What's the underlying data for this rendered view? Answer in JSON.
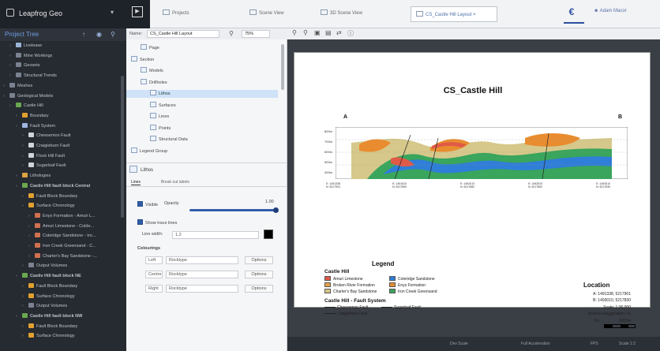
{
  "app": {
    "title": "Leapfrog Geo",
    "tabs": [
      {
        "label": "Projects"
      },
      {
        "label": "Scene View"
      },
      {
        "label": "3D Scene View"
      },
      {
        "label": "CS_Castle Hill Layout ×"
      }
    ],
    "user": "Adam Macor"
  },
  "tree": {
    "title": "Project Tree",
    "items": [
      {
        "label": "Livelease",
        "indent": 1,
        "color": "#9bb3d6"
      },
      {
        "label": "Mine Workings",
        "indent": 1,
        "color": "#7a8290"
      },
      {
        "label": "Geosets",
        "indent": 1,
        "color": "#7a8290"
      },
      {
        "label": "Structural Trends",
        "indent": 1,
        "color": "#7a8290"
      },
      {
        "label": "Meshes",
        "indent": 0,
        "color": "#7a8290"
      },
      {
        "label": "Geological Models",
        "indent": 0,
        "color": "#7a8290"
      },
      {
        "label": "Castle Hill",
        "indent": 1,
        "color": "#6aa84f"
      },
      {
        "label": "Boundary",
        "indent": 2,
        "color": "#e0a030"
      },
      {
        "label": "Fault System",
        "indent": 2,
        "color": "#9fb7e0"
      },
      {
        "label": "Cheesemon Fault",
        "indent": 3,
        "color": "#cfd3da"
      },
      {
        "label": "Craigieburn Fault",
        "indent": 3,
        "color": "#cfd3da"
      },
      {
        "label": "Flock Hill Fault",
        "indent": 3,
        "color": "#cfd3da"
      },
      {
        "label": "Sugarloaf Fault",
        "indent": 3,
        "color": "#cfd3da"
      },
      {
        "label": "Lithologies",
        "indent": 2,
        "color": "#d9a441"
      },
      {
        "label": "Castle Hill fault block Central",
        "indent": 2,
        "color": "#6aa84f",
        "bold": true
      },
      {
        "label": "Fault Block Boundary",
        "indent": 3,
        "color": "#e0a030"
      },
      {
        "label": "Surface Chronology",
        "indent": 3,
        "color": "#e0a030"
      },
      {
        "label": "Enys Formation - Amuri L...",
        "indent": 4,
        "color": "#d07050"
      },
      {
        "label": "Amuri Limestone - Colde...",
        "indent": 4,
        "color": "#d07050"
      },
      {
        "label": "Coleridge Sandstone - Iro...",
        "indent": 4,
        "color": "#d07050"
      },
      {
        "label": "Iron Creek Greensand - C...",
        "indent": 4,
        "color": "#d07050"
      },
      {
        "label": "Charter's Bay Sandstone -...",
        "indent": 4,
        "color": "#d07050"
      },
      {
        "label": "Output Volumes",
        "indent": 3,
        "color": "#7a8290"
      },
      {
        "label": "Castle Hill fault block NE",
        "indent": 2,
        "color": "#6aa84f",
        "bold": true
      },
      {
        "label": "Fault Block Boundary",
        "indent": 3,
        "color": "#e0a030"
      },
      {
        "label": "Surface Chronology",
        "indent": 3,
        "color": "#e0a030"
      },
      {
        "label": "Output Volumes",
        "indent": 3,
        "color": "#7a8290"
      },
      {
        "label": "Castle Hill fault block NW",
        "indent": 2,
        "color": "#6aa84f",
        "bold": true
      },
      {
        "label": "Fault Block Boundary",
        "indent": 3,
        "color": "#e0a030"
      },
      {
        "label": "Surface Chronology",
        "indent": 3,
        "color": "#e0a030"
      }
    ]
  },
  "props": {
    "name_label": "Name:",
    "name_value": "CS_Castle Hill Layout",
    "zoom_value": "75%",
    "items": [
      {
        "label": "Page",
        "indent": 1
      },
      {
        "label": "Section",
        "indent": 0
      },
      {
        "label": "Models",
        "indent": 1
      },
      {
        "label": "Drillholes",
        "indent": 1
      },
      {
        "label": "Lithos",
        "indent": 2,
        "selected": true
      },
      {
        "label": "Surfaces",
        "indent": 2
      },
      {
        "label": "Lines",
        "indent": 2
      },
      {
        "label": "Points",
        "indent": 2
      },
      {
        "label": "Structural Data",
        "indent": 2
      },
      {
        "label": "Legend Group",
        "indent": 0
      }
    ],
    "section_title": "Lithos",
    "subtabs": [
      "Lines",
      "Break out labels"
    ],
    "visible_label": "Visible",
    "opacity_label": "Opacity",
    "opacity_value": "1.00",
    "show_trace_label": "Show trace lines",
    "line_width_label": "Line width:",
    "line_width_value": "1.2",
    "colourings_label": "Colourings",
    "colourings": [
      {
        "side": "Left",
        "value": "Rocktype",
        "options": "Options"
      },
      {
        "side": "Centre",
        "value": "Rocktype",
        "options": "Options"
      },
      {
        "side": "Right",
        "value": "Rocktype",
        "options": "Options"
      }
    ]
  },
  "canvas": {
    "toolbar_icons": [
      "zoom-in-icon",
      "zoom-out-icon",
      "zoom-fit-icon",
      "export-icon",
      "refresh-icon",
      "help-icon"
    ],
    "status": [
      "Dev Scale",
      "Full Acceleration",
      "FPS",
      "Scale 1:2"
    ]
  },
  "layout_doc": {
    "title": "CS_Castle Hill",
    "end_a": "A",
    "end_b": "B",
    "elevations": [
      "800m",
      "700m",
      "600m",
      "500m",
      "400m"
    ],
    "coords": [
      {
        "e": "E: 1491338",
        "n": "N: 5217901"
      },
      {
        "e": "E: 1491610",
        "n": "N: 5217890"
      },
      {
        "e": "E: 1492010",
        "n": "N: 5217882"
      },
      {
        "e": "E: 1492510",
        "n": "N: 5217852"
      },
      {
        "e": "E: 1493010",
        "n": "N: 5217830"
      }
    ],
    "legend_title": "Legend",
    "legend_group1": "Castle Hill",
    "legend_items": [
      {
        "label": "Amuri Limestone",
        "color": "#e05a47"
      },
      {
        "label": "Broken River Formation",
        "color": "#e8a24a"
      },
      {
        "label": "Charter's Bay Sandstone",
        "color": "#d6c88a"
      },
      {
        "label": "Coleridge Sandstone",
        "color": "#2f7ed8"
      },
      {
        "label": "Enys Formation",
        "color": "#e98c2f"
      },
      {
        "label": "Iron Creek Greensand",
        "color": "#3aa55c"
      }
    ],
    "legend_group2": "Castle Hill - Fault System",
    "fault_items": [
      "Cheesemon Fault",
      "Sugarloaf Fault",
      "Craigieburn Fault"
    ],
    "location_title": "Location",
    "location_a": "A:  1491338, 5217901",
    "location_b": "B:  1493010, 5217830",
    "scale_text": "Scale: 1:36,000",
    "vert_exag": "Vertical exaggeration: 3x",
    "scale_left": "0m",
    "scale_right": "1000m"
  }
}
